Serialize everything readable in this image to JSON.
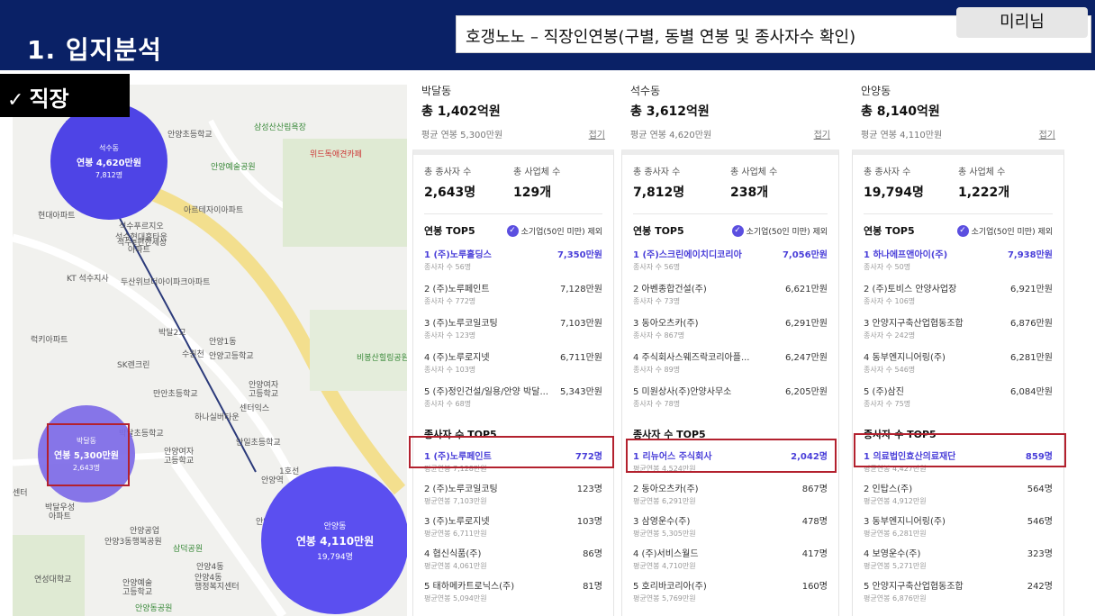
{
  "slide": {
    "title": "1. 입지분석",
    "topic": "호갱노노 – 직장인연봉(구별, 동별 연봉 및 종사자수 확인)",
    "author": "미리님",
    "section_tag": "직장",
    "section_icon": "check-icon"
  },
  "map": {
    "bubbles": [
      {
        "name": "석수동",
        "salary": "연봉 4,620만원",
        "employees": "7,812명",
        "color": "#4e44e6"
      },
      {
        "name": "박달동",
        "salary": "연봉 5,300만원",
        "employees": "2,643명",
        "color": "#7d6be8"
      },
      {
        "name": "안양동",
        "salary": "연봉 4,110만원",
        "employees": "19,794명",
        "color": "#5b4ff0"
      }
    ],
    "labels": {
      "l1": "삼성산산림욕장",
      "l2": "안양초등학교",
      "l3": "위드독애견카페",
      "l4": "안양예술공원",
      "l5": "현대아파트",
      "l6": "아르테자이아파트",
      "l7": "석수푸르지오",
      "l8": "석수현대홈타운",
      "l9": "석수e편한세상",
      "l10": "아파트",
      "l11": "KT 석수지사",
      "l12": "두산위브더아이파크아파트",
      "l13": "럭키아파트",
      "l14": "박달2교",
      "l15": "수원천",
      "l16": "안양1동",
      "l17": "안양고등학교",
      "l18": "SK렌크린",
      "l19": "비봉산힐링공원",
      "l20": "안양여자",
      "l21": "고등학교",
      "l22": "만안초등학교",
      "l23": "하나실버타운",
      "l24": "센터익스",
      "l25": "박달초등학교",
      "l26": "안양여자",
      "l27": "고등학교",
      "l28": "안일초등학교",
      "l29": "1호선",
      "l30": "안양역",
      "l31": "박달우성",
      "l32": "아파트",
      "l33": "안양공업",
      "l34": "안양3동행복공원",
      "l35": "삼덕공원",
      "l36": "안양4동",
      "l37": "안양4동",
      "l38": "행정복지센터",
      "l39": "연성대학교",
      "l40": "안양예술",
      "l41": "고등학교",
      "l42": "안양동공원",
      "l43": "센터",
      "l44": "안양중앙시장"
    }
  },
  "panels": [
    {
      "dong": "박달동",
      "total": "총 1,402억원",
      "avg": "평균 연봉 5,300만원",
      "fold": "접기",
      "employees_label": "총 종사자 수",
      "employees": "2,643명",
      "companies_label": "총 사업체 수",
      "companies": "129개",
      "top5_salary_title": "연봉 TOP5",
      "exclude_label": "소기업(50인 미만) 제외",
      "salary_top5": [
        {
          "name": "1 (주)노루홀딩스",
          "value": "7,350만원",
          "sub": "종사자 수 56명"
        },
        {
          "name": "2 (주)노루페인트",
          "value": "7,128만원",
          "sub": "종사자 수 772명"
        },
        {
          "name": "3 (주)노루코일코팅",
          "value": "7,103만원",
          "sub": "종사자 수 123명"
        },
        {
          "name": "4 (주)노루로지넷",
          "value": "6,711만원",
          "sub": "종사자 수 103명"
        },
        {
          "name": "5 (주)정인건설/일용/안양 박달...",
          "value": "5,343만원",
          "sub": "종사자 수 68명"
        }
      ],
      "top5_emp_title": "종사자 수 TOP5",
      "emp_top5": [
        {
          "name": "1 (주)노루페인트",
          "value": "772명",
          "sub": "평균연봉 7,128만원"
        },
        {
          "name": "2 (주)노루코일코팅",
          "value": "123명",
          "sub": "평균연봉 7,103만원"
        },
        {
          "name": "3 (주)노루로지넷",
          "value": "103명",
          "sub": "평균연봉 6,711만원"
        },
        {
          "name": "4 협신식품(주)",
          "value": "86명",
          "sub": "평균연봉 4,061만원"
        },
        {
          "name": "5 태하메카트로닉스(주)",
          "value": "81명",
          "sub": "평균연봉 5,094만원"
        }
      ]
    },
    {
      "dong": "석수동",
      "total": "총 3,612억원",
      "avg": "평균 연봉 4,620만원",
      "fold": "접기",
      "employees_label": "총 종사자 수",
      "employees": "7,812명",
      "companies_label": "총 사업체 수",
      "companies": "238개",
      "top5_salary_title": "연봉 TOP5",
      "exclude_label": "소기업(50인 미만) 제외",
      "salary_top5": [
        {
          "name": "1 (주)스크린에이치디코리아",
          "value": "7,056만원",
          "sub": "종사자 수 56명"
        },
        {
          "name": "2 아벤종합건설(주)",
          "value": "6,621만원",
          "sub": "종사자 수 73명"
        },
        {
          "name": "3 동아오츠카(주)",
          "value": "6,291만원",
          "sub": "종사자 수 867명"
        },
        {
          "name": "4 주식회사스웨즈락코리아플...",
          "value": "6,247만원",
          "sub": "종사자 수 89명"
        },
        {
          "name": "5 미원상사(주)안양사무소",
          "value": "6,205만원",
          "sub": "종사자 수 78명"
        }
      ],
      "top5_emp_title": "종사자 수 TOP5",
      "emp_top5": [
        {
          "name": "1 리뉴어스 주식회사",
          "value": "2,042명",
          "sub": "평균연봉 4,524만원"
        },
        {
          "name": "2 동아오츠카(주)",
          "value": "867명",
          "sub": "평균연봉 6,291만원"
        },
        {
          "name": "3 삼영운수(주)",
          "value": "478명",
          "sub": "평균연봉 5,305만원"
        },
        {
          "name": "4 (주)서비스월드",
          "value": "417명",
          "sub": "평균연봉 4,710만원"
        },
        {
          "name": "5 호리바코리아(주)",
          "value": "160명",
          "sub": "평균연봉 5,769만원"
        }
      ]
    },
    {
      "dong": "안양동",
      "total": "총 8,140억원",
      "avg": "평균 연봉 4,110만원",
      "fold": "접기",
      "employees_label": "총 종사자 수",
      "employees": "19,794명",
      "companies_label": "총 사업체 수",
      "companies": "1,222개",
      "top5_salary_title": "연봉 TOP5",
      "exclude_label": "소기업(50인 미만) 제외",
      "salary_top5": [
        {
          "name": "1 하나에프앤아이(주)",
          "value": "7,938만원",
          "sub": "종사자 수 50명"
        },
        {
          "name": "2 (주)토비스 안양사업장",
          "value": "6,921만원",
          "sub": "종사자 수 106명"
        },
        {
          "name": "3 안양지구축산업협동조합",
          "value": "6,876만원",
          "sub": "종사자 수 242명"
        },
        {
          "name": "4 동부엔지니어링(주)",
          "value": "6,281만원",
          "sub": "종사자 수 546명"
        },
        {
          "name": "5 (주)삼진",
          "value": "6,084만원",
          "sub": "종사자 수 75명"
        }
      ],
      "top5_emp_title": "종사자 수 TOP5",
      "emp_top5": [
        {
          "name": "1 의료법인효산의료재단",
          "value": "859명",
          "sub": "평균연봉 4,427만원"
        },
        {
          "name": "2 인탑스(주)",
          "value": "564명",
          "sub": "평균연봉 4,912만원"
        },
        {
          "name": "3 동부엔지니어링(주)",
          "value": "546명",
          "sub": "평균연봉 6,281만원"
        },
        {
          "name": "4 보영운수(주)",
          "value": "323명",
          "sub": "평균연봉 5,271만원"
        },
        {
          "name": "5 안양지구축산업협동조합",
          "value": "242명",
          "sub": "평균연봉 6,876만원"
        }
      ]
    }
  ],
  "colors": {
    "header_bg": "#0a2166",
    "accent_purple": "#4a3fd9",
    "highlight_red": "#b3212e"
  }
}
